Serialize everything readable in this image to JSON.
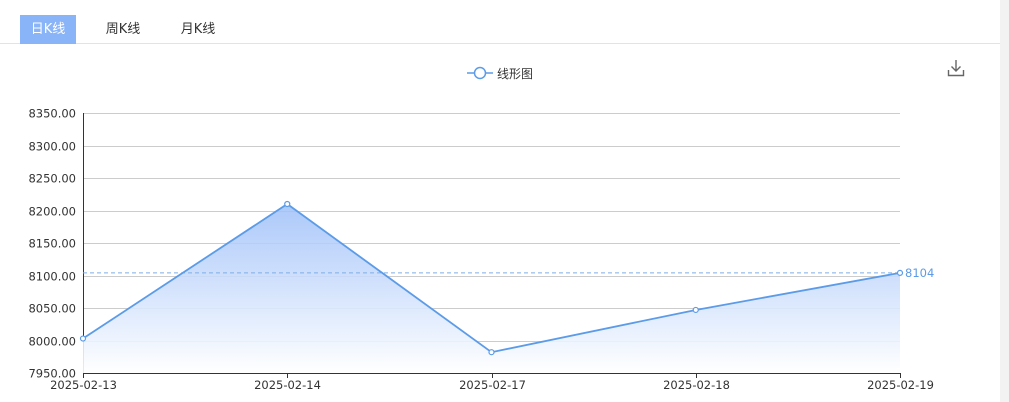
{
  "tabs": [
    {
      "label": "日K线",
      "active": true
    },
    {
      "label": "周K线",
      "active": false
    },
    {
      "label": "月K线",
      "active": false
    }
  ],
  "toolbar": {
    "download_icon": "download-icon"
  },
  "chart_data": {
    "type": "area",
    "legend": "线形图",
    "categories": [
      "2025-02-13",
      "2025-02-14",
      "2025-02-17",
      "2025-02-18",
      "2025-02-19"
    ],
    "series": [
      {
        "name": "线形图",
        "values": [
          8003,
          8210,
          7982,
          8047,
          8104
        ]
      }
    ],
    "yticks": [
      "7950.00",
      "8000.00",
      "8050.00",
      "8100.00",
      "8150.00",
      "8200.00",
      "8250.00",
      "8300.00",
      "8350.00"
    ],
    "ylim": [
      7950,
      8350
    ],
    "reference_line": {
      "value": 8104,
      "label": "8104"
    },
    "colors": {
      "line": "#5b9be8",
      "fill_top": "#9dbff9",
      "fill_bottom": "#ffffff",
      "grid": "#cccccc",
      "reference": "#7eaee8"
    },
    "grid": true,
    "legend_position": "top-center"
  }
}
